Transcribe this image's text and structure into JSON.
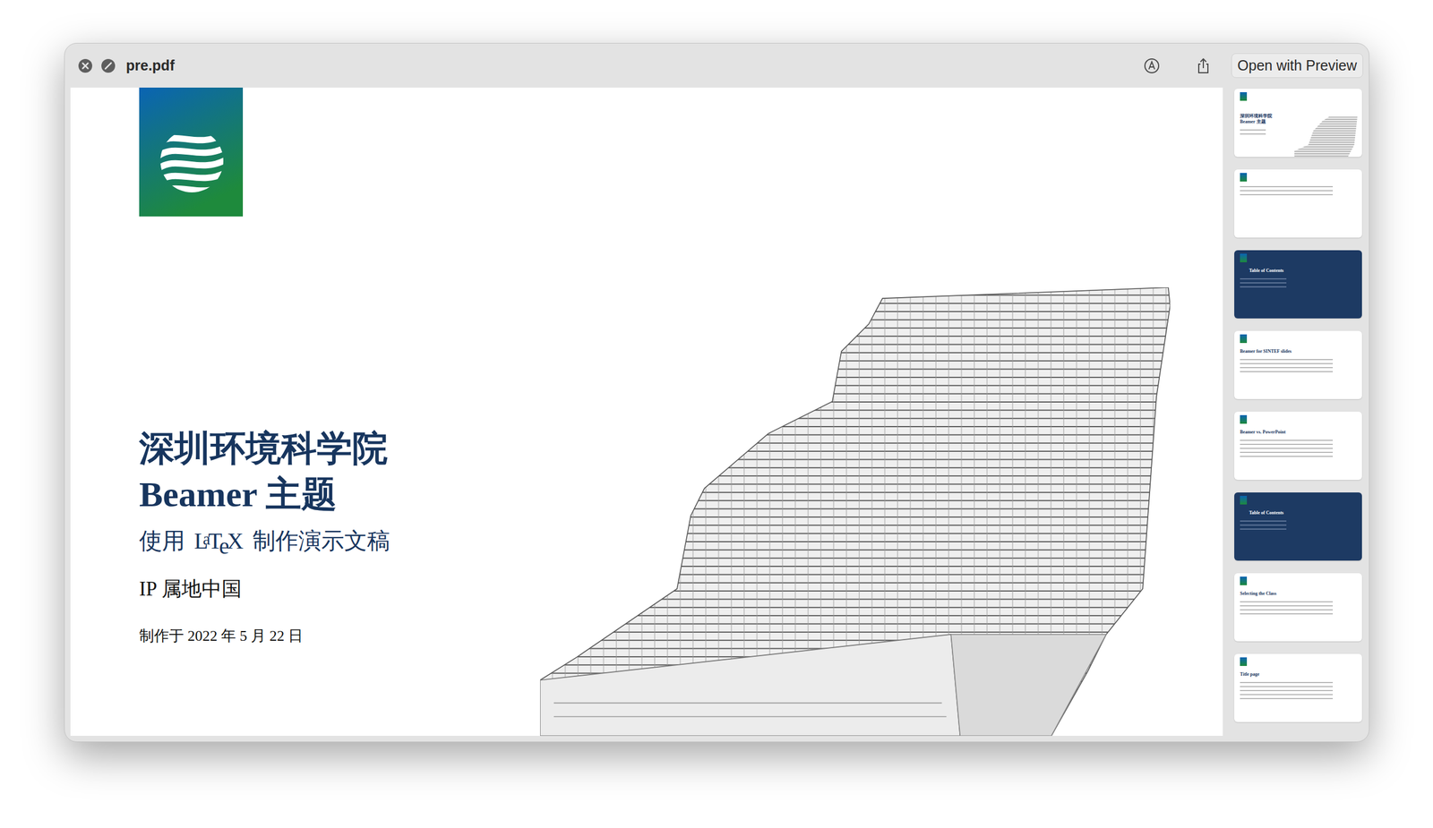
{
  "window": {
    "title": "pre.pdf"
  },
  "toolbar": {
    "button": "Open with Preview"
  },
  "slide": {
    "title_lines": [
      "深圳环境科学院",
      "Beamer 主题"
    ],
    "subtitle": {
      "before": "使用",
      "logo": "LaTeX",
      "after": "制作演示文稿"
    },
    "author": "IP 属地中国",
    "date": "制作于 2022 年 5 月 22 日"
  },
  "thumbnails": [
    {
      "kind": "title",
      "title": "深圳环境科学院 Beamer 主题",
      "lines": 2
    },
    {
      "kind": "text",
      "title": "",
      "lines": 3
    },
    {
      "kind": "toc",
      "title": "Table of Contents",
      "lines": 3
    },
    {
      "kind": "content",
      "title": "Beamer for SINTEF slides",
      "lines": 4
    },
    {
      "kind": "content",
      "title": "Beamer vs. PowerPoint",
      "lines": 5
    },
    {
      "kind": "toc",
      "title": "Table of Contents",
      "lines": 3
    },
    {
      "kind": "content",
      "title": "Selecting the Class",
      "lines": 4
    },
    {
      "kind": "content",
      "title": "Title page",
      "lines": 5
    }
  ]
}
